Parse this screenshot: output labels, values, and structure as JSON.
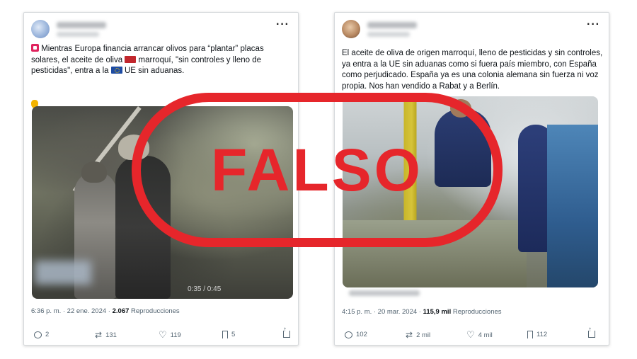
{
  "left_post": {
    "lines": [
      "Mientras Europa financia arrancar olivos para “plantar” placas",
      "solares, el aceite de oliva",
      "marroquí, \"sin controles y lleno de",
      "pesticidas\", entra a la",
      "UE sin aduanas."
    ],
    "video_time": "0:35 / 0:45",
    "meta_time": "6:36 p. m. · 22 ene. 2024 · ",
    "views": "2.067",
    "views_label": " Reproducciones",
    "replies": "2",
    "reposts": "131",
    "likes": "119",
    "bookmarks": "5"
  },
  "right_post": {
    "lines": [
      "El aceite de oliva de origen marroquí, lleno de pesticidas y sin controles,",
      "ya entra a la UE sin aduanas como si fuera país miembro, con España",
      "como perjudicado. España ya es una colonia alemana sin fuerza ni voz",
      "propia. Nos han vendido a Rabat y a Berlín."
    ],
    "meta_time": "4:15 p. m. · 20 mar. 2024 · ",
    "views": "115,9 mil",
    "views_label": " Reproducciones",
    "replies": "102",
    "reposts": "2 mil",
    "likes": "4 mil",
    "bookmarks": "112"
  },
  "stamp": {
    "label": "FALSO",
    "color": "#e6262b"
  },
  "icons": [
    "more-icon",
    "reply-icon",
    "repost-icon",
    "like-icon",
    "bookmark-icon",
    "share-icon",
    "siren-icon",
    "morocco-flag-icon",
    "eu-flag-icon",
    "pointing-down-icon"
  ]
}
